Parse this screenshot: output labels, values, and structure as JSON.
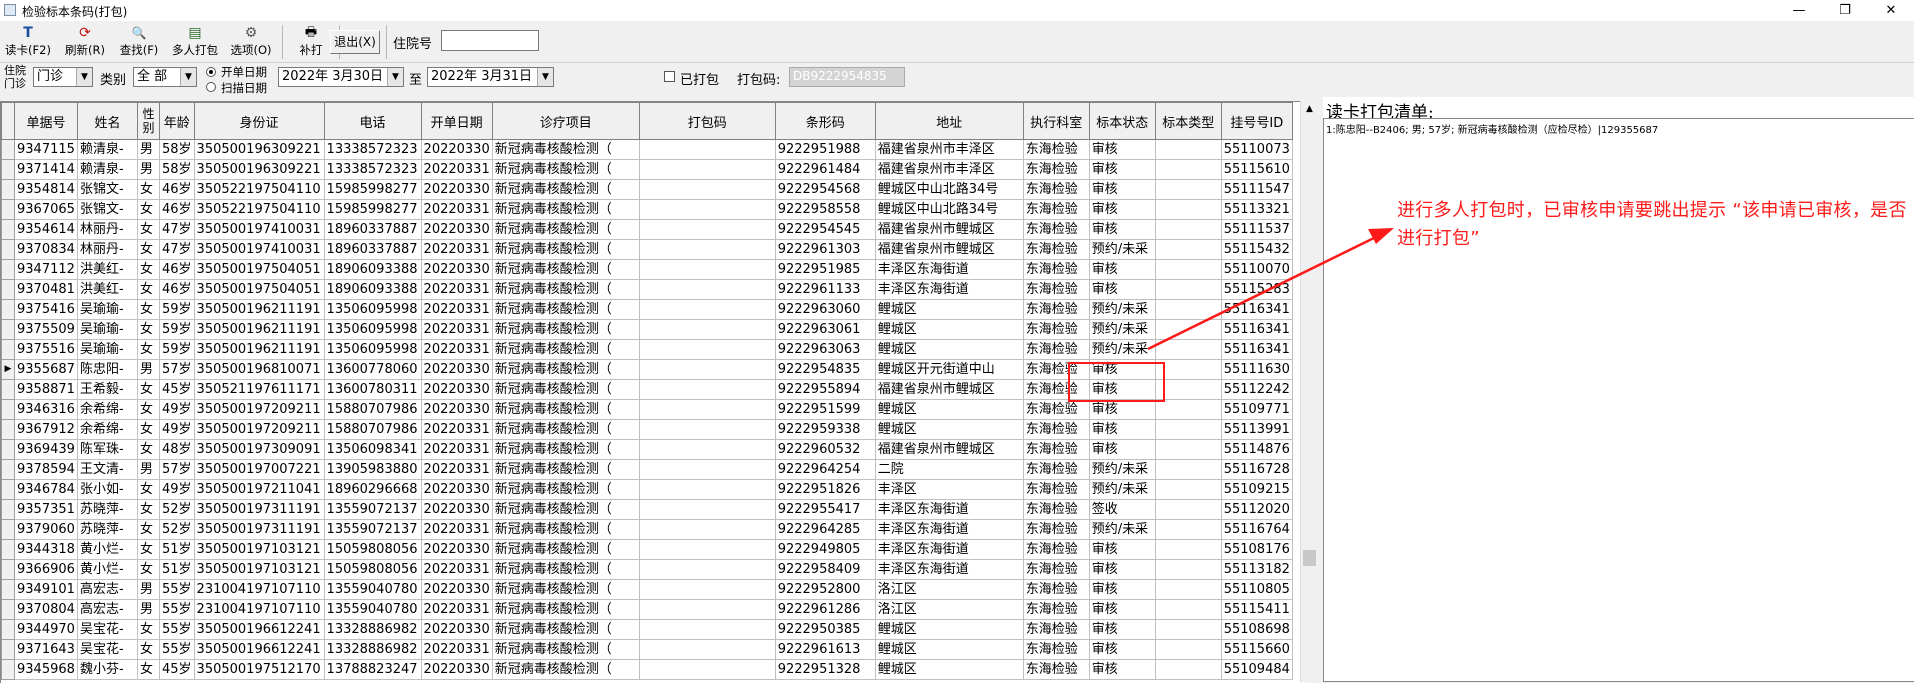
{
  "window": {
    "title": "检验标本条码(打包)"
  },
  "toolbar": {
    "buttons": [
      {
        "label": "读卡(F2)",
        "icon": "T"
      },
      {
        "label": "刷新(R)",
        "icon": "⟳"
      },
      {
        "label": "查找(F)",
        "icon": "🔍"
      },
      {
        "label": "多人打包",
        "icon": "▤"
      },
      {
        "label": "选项(O)",
        "icon": "⚙"
      },
      {
        "label": "补打",
        "icon": "🖶"
      }
    ],
    "exit_label": "退出(X)",
    "hospital_no_label": "住院号",
    "hospital_no_value": ""
  },
  "filter": {
    "mode_label": "住院门诊",
    "mode_value": "门诊",
    "category_label": "类别",
    "category_value": "全 部",
    "radio_open_date": "开单日期",
    "radio_scan_date": "扫描日期",
    "date_from": "2022年 3月30日",
    "to_label": "至",
    "date_to": "2022年 3月31日",
    "packed_label": "已打包",
    "pack_code_label": "打包码:",
    "pack_code_value": "DB9222954835"
  },
  "table": {
    "headers": [
      "单据号",
      "姓名",
      "性别",
      "年龄",
      "身份证",
      "电话",
      "开单日期",
      "诊疗项目",
      "打包码",
      "条形码",
      "地址",
      "执行科室",
      "标本状态",
      "标本类型",
      "挂号号ID"
    ],
    "rows": [
      [
        "9347115",
        "赖清泉-",
        "男",
        "58岁",
        "350500196309221",
        "13338572323",
        "20220330",
        "新冠病毒核酸检测（",
        "",
        "9222951988",
        "福建省泉州市丰泽区",
        "东海检验",
        "审核",
        "",
        "55110073"
      ],
      [
        "9371414",
        "赖清泉-",
        "男",
        "58岁",
        "350500196309221",
        "13338572323",
        "20220331",
        "新冠病毒核酸检测（",
        "",
        "9222961484",
        "福建省泉州市丰泽区",
        "东海检验",
        "审核",
        "",
        "55115610"
      ],
      [
        "9354814",
        "张锦文-",
        "女",
        "46岁",
        "350522197504110",
        "15985998277",
        "20220330",
        "新冠病毒核酸检测（",
        "",
        "9222954568",
        "鲤城区中山北路34号",
        "东海检验",
        "审核",
        "",
        "55111547"
      ],
      [
        "9367065",
        "张锦文-",
        "女",
        "46岁",
        "350522197504110",
        "15985998277",
        "20220331",
        "新冠病毒核酸检测（",
        "",
        "9222958558",
        "鲤城区中山北路34号",
        "东海检验",
        "审核",
        "",
        "55113321"
      ],
      [
        "9354614",
        "林丽丹-",
        "女",
        "47岁",
        "350500197410031",
        "18960337887",
        "20220330",
        "新冠病毒核酸检测（",
        "",
        "9222954545",
        "福建省泉州市鲤城区",
        "东海检验",
        "审核",
        "",
        "55111537"
      ],
      [
        "9370834",
        "林丽丹-",
        "女",
        "47岁",
        "350500197410031",
        "18960337887",
        "20220331",
        "新冠病毒核酸检测（",
        "",
        "9222961303",
        "福建省泉州市鲤城区",
        "东海检验",
        "预约/未采",
        "",
        "55115432"
      ],
      [
        "9347112",
        "洪美红-",
        "女",
        "46岁",
        "350500197504051",
        "18906093388",
        "20220330",
        "新冠病毒核酸检测（",
        "",
        "9222951985",
        "丰泽区东海街道",
        "东海检验",
        "审核",
        "",
        "55110070"
      ],
      [
        "9370481",
        "洪美红-",
        "女",
        "46岁",
        "350500197504051",
        "18906093388",
        "20220331",
        "新冠病毒核酸检测（",
        "",
        "9222961133",
        "丰泽区东海街道",
        "东海检验",
        "审核",
        "",
        "55115283"
      ],
      [
        "9375416",
        "吴瑜瑜-",
        "女",
        "59岁",
        "350500196211191",
        "13506095998",
        "20220331",
        "新冠病毒核酸检测（",
        "",
        "9222963060",
        "鲤城区",
        "东海检验",
        "预约/未采",
        "",
        "55116341"
      ],
      [
        "9375509",
        "吴瑜瑜-",
        "女",
        "59岁",
        "350500196211191",
        "13506095998",
        "20220331",
        "新冠病毒核酸检测（",
        "",
        "9222963061",
        "鲤城区",
        "东海检验",
        "预约/未采",
        "",
        "55116341"
      ],
      [
        "9375516",
        "吴瑜瑜-",
        "女",
        "59岁",
        "350500196211191",
        "13506095998",
        "20220331",
        "新冠病毒核酸检测（",
        "",
        "9222963063",
        "鲤城区",
        "东海检验",
        "预约/未采",
        "",
        "55116341"
      ],
      [
        "9355687",
        "陈忠阳-",
        "男",
        "57岁",
        "350500196810071",
        "13600778060",
        "20220330",
        "新冠病毒核酸检测（",
        "",
        "9222954835",
        "鲤城区开元街道中山",
        "东海检验",
        "审核",
        "",
        "55111630"
      ],
      [
        "9358871",
        "王希毅-",
        "女",
        "45岁",
        "350521197611171",
        "13600780311",
        "20220330",
        "新冠病毒核酸检测（",
        "",
        "9222955894",
        "福建省泉州市鲤城区",
        "东海检验",
        "审核",
        "",
        "55112242"
      ],
      [
        "9346316",
        "余希绵-",
        "女",
        "49岁",
        "350500197209211",
        "15880707986",
        "20220330",
        "新冠病毒核酸检测（",
        "",
        "9222951599",
        "鲤城区",
        "东海检验",
        "审核",
        "",
        "55109771"
      ],
      [
        "9367912",
        "余希绵-",
        "女",
        "49岁",
        "350500197209211",
        "15880707986",
        "20220331",
        "新冠病毒核酸检测（",
        "",
        "9222959338",
        "鲤城区",
        "东海检验",
        "审核",
        "",
        "55113991"
      ],
      [
        "9369439",
        "陈军珠-",
        "女",
        "48岁",
        "350500197309091",
        "13506098341",
        "20220331",
        "新冠病毒核酸检测（",
        "",
        "9222960532",
        "福建省泉州市鲤城区",
        "东海检验",
        "审核",
        "",
        "55114876"
      ],
      [
        "9378594",
        "王文清-",
        "男",
        "57岁",
        "350500197007221",
        "13905983880",
        "20220331",
        "新冠病毒核酸检测（",
        "",
        "9222964254",
        "二院",
        "东海检验",
        "预约/未采",
        "",
        "55116728"
      ],
      [
        "9346784",
        "张小如-",
        "女",
        "49岁",
        "350500197211041",
        "18960296668",
        "20220330",
        "新冠病毒核酸检测（",
        "",
        "9222951826",
        "丰泽区",
        "东海检验",
        "预约/未采",
        "",
        "55109215"
      ],
      [
        "9357351",
        "苏晓萍-",
        "女",
        "52岁",
        "350500197311191",
        "13559072137",
        "20220330",
        "新冠病毒核酸检测（",
        "",
        "9222955417",
        "丰泽区东海街道",
        "东海检验",
        "签收",
        "",
        "55112020"
      ],
      [
        "9379060",
        "苏晓萍-",
        "女",
        "52岁",
        "350500197311191",
        "13559072137",
        "20220331",
        "新冠病毒核酸检测（",
        "",
        "9222964285",
        "丰泽区东海街道",
        "东海检验",
        "预约/未采",
        "",
        "55116764"
      ],
      [
        "9344318",
        "黄小烂-",
        "女",
        "51岁",
        "350500197103121",
        "15059808056",
        "20220330",
        "新冠病毒核酸检测（",
        "",
        "9222949805",
        "丰泽区东海街道",
        "东海检验",
        "审核",
        "",
        "55108176"
      ],
      [
        "9366906",
        "黄小烂-",
        "女",
        "51岁",
        "350500197103121",
        "15059808056",
        "20220331",
        "新冠病毒核酸检测（",
        "",
        "9222958409",
        "丰泽区东海街道",
        "东海检验",
        "审核",
        "",
        "55113182"
      ],
      [
        "9349101",
        "高宏志-",
        "男",
        "55岁",
        "231004197107110",
        "13559040780",
        "20220330",
        "新冠病毒核酸检测（",
        "",
        "9222952800",
        "洛江区",
        "东海检验",
        "审核",
        "",
        "55110805"
      ],
      [
        "9370804",
        "高宏志-",
        "男",
        "55岁",
        "231004197107110",
        "13559040780",
        "20220331",
        "新冠病毒核酸检测（",
        "",
        "9222961286",
        "洛江区",
        "东海检验",
        "审核",
        "",
        "55115411"
      ],
      [
        "9344970",
        "吴宝花-",
        "女",
        "55岁",
        "350500196612241",
        "13328886982",
        "20220330",
        "新冠病毒核酸检测（",
        "",
        "9222950385",
        "鲤城区",
        "东海检验",
        "审核",
        "",
        "55108698"
      ],
      [
        "9371643",
        "吴宝花-",
        "女",
        "55岁",
        "350500196612241",
        "13328886982",
        "20220331",
        "新冠病毒核酸检测（",
        "",
        "9222961613",
        "鲤城区",
        "东海检验",
        "审核",
        "",
        "55115660"
      ],
      [
        "9345968",
        "魏小芬-",
        "女",
        "45岁",
        "350500197512170",
        "13788823247",
        "20220330",
        "新冠病毒核酸检测（",
        "",
        "9222951328",
        "鲤城区",
        "东海检验",
        "审核",
        "",
        "55109484"
      ]
    ],
    "current_row_index": 11
  },
  "pack_list": {
    "title": "读卡打包清单:",
    "items": [
      "1:陈忠阳--B2406; 男; 57岁; 新冠病毒核酸检测（应检尽检）|129355687"
    ]
  },
  "annotation": {
    "text": "进行多人打包时，已审核申请要跳出提示 “该申请已审核，是否进行打包”",
    "color": "#ff1a1a"
  }
}
